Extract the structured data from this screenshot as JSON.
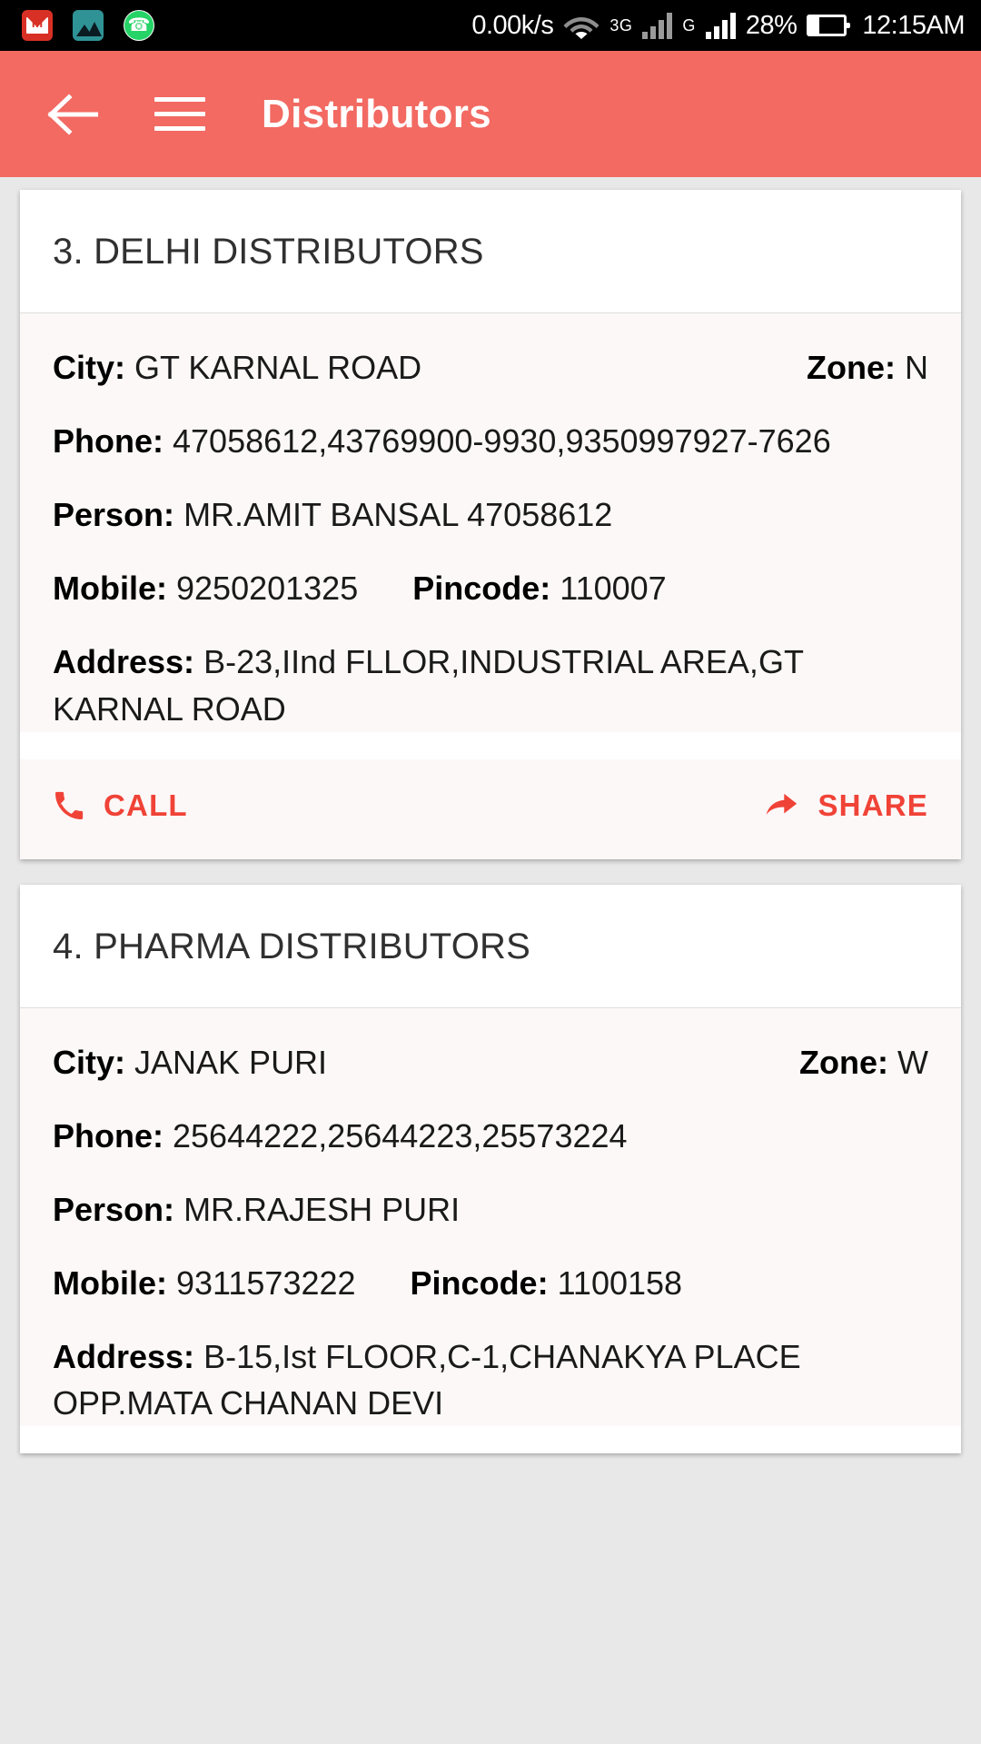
{
  "status_bar": {
    "notification_icons": [
      "gmail-icon",
      "gallery-icon",
      "whatsapp-icon"
    ],
    "network_speed": "0.00k/s",
    "wifi": "wifi-icon",
    "network_type": "3G",
    "signal_1": "signal-bars-icon",
    "sim_2_label": "G",
    "signal_2": "signal-bars-icon",
    "battery_percent": "28%",
    "battery_level": 28,
    "clock": "12:15AM"
  },
  "app_bar": {
    "back": "back-arrow-icon",
    "menu": "hamburger-menu-icon",
    "title": "Distributors",
    "background_color": "#F26A62"
  },
  "labels": {
    "city": "City:",
    "zone": "Zone:",
    "phone": "Phone:",
    "person": "Person:",
    "mobile": "Mobile:",
    "pincode": "Pincode:",
    "address": "Address:"
  },
  "actions": {
    "call_label": "CALL",
    "share_label": "SHARE",
    "accent_color": "#F04337"
  },
  "cards": [
    {
      "title": "3. DELHI DISTRIBUTORS",
      "city": "GT KARNAL ROAD",
      "zone": "N",
      "phone": "47058612,43769900-9930,9350997927-7626",
      "person": "MR.AMIT BANSAL 47058612",
      "mobile": "9250201325",
      "pincode": "110007",
      "address": "B-23,IInd FLLOR,INDUSTRIAL AREA,GT KARNAL ROAD"
    },
    {
      "title": "4. PHARMA DISTRIBUTORS",
      "city": "JANAK PURI",
      "zone": "W",
      "phone": "25644222,25644223,25573224",
      "person": "MR.RAJESH PURI",
      "mobile": "9311573222",
      "pincode": "1100158",
      "address": "B-15,Ist FLOOR,C-1,CHANAKYA PLACE OPP.MATA CHANAN DEVI"
    }
  ]
}
